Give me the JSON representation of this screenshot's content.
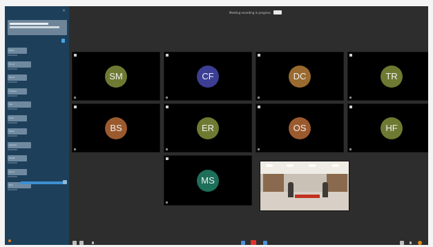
{
  "meeting": {
    "title": "Meeting recording in progress"
  },
  "chat": {
    "pinned": "Welcome to the meeting",
    "messages": [
      "Hello",
      "Hi all",
      "Good",
      "Thanks",
      "Yes",
      "Sure",
      "Okay",
      "Agreed",
      "Great",
      "Done",
      "Bye"
    ]
  },
  "participants": [
    {
      "initials": "SM",
      "color": "#6e7a32"
    },
    {
      "initials": "CF",
      "color": "#3c3e93"
    },
    {
      "initials": "DC",
      "color": "#9a6a2e"
    },
    {
      "initials": "TR",
      "color": "#6e7a32"
    },
    {
      "initials": "BS",
      "color": "#9a5a2e"
    },
    {
      "initials": "ER",
      "color": "#6e7a32"
    },
    {
      "initials": "OS",
      "color": "#9a5a2e"
    },
    {
      "initials": "HF",
      "color": "#6e7a32"
    },
    {
      "initials": "MS",
      "color": "#1d6f5a"
    }
  ],
  "colors": {
    "accent": "#3d8fd1",
    "end_call": "#e0322b",
    "chat_bg": "#1d3f5a",
    "stage_bg": "#2d2d2d"
  }
}
